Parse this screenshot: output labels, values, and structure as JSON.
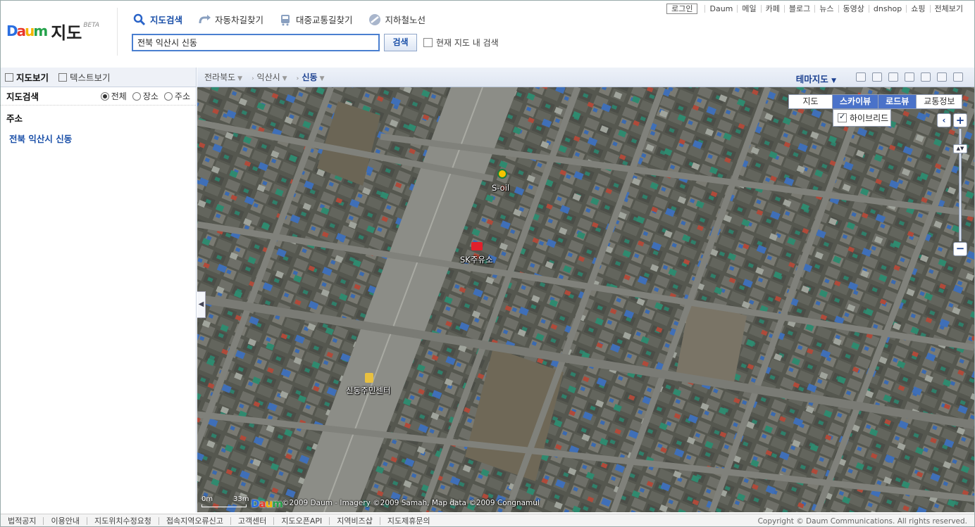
{
  "header": {
    "logo_brand": "Daum",
    "logo_title": "지도",
    "logo_badge": "BETA",
    "nav": [
      {
        "label": "지도검색",
        "icon": "magnifier-icon",
        "active": true
      },
      {
        "label": "자동차길찾기",
        "icon": "car-route-icon",
        "active": false
      },
      {
        "label": "대중교통길찾기",
        "icon": "bus-icon",
        "active": false
      },
      {
        "label": "지하철노선",
        "icon": "subway-icon",
        "active": false
      }
    ],
    "search": {
      "value": "전북 익산시 신동",
      "button": "검색",
      "in_map_label": "현재 지도 내 검색",
      "in_map_checked": false
    },
    "top_links": {
      "login": "로그인",
      "links": [
        "Daum",
        "메일",
        "카페",
        "블로그",
        "뉴스",
        "동영상",
        "dnshop",
        "쇼핑",
        "전체보기"
      ]
    }
  },
  "left_panel": {
    "tabs": [
      {
        "label": "지도보기",
        "active": true
      },
      {
        "label": "텍스트보기",
        "active": false
      }
    ],
    "search_title": "지도검색",
    "search_types": [
      {
        "label": "전체",
        "selected": true
      },
      {
        "label": "장소",
        "selected": false
      },
      {
        "label": "주소",
        "selected": false
      }
    ],
    "result_header": "주소",
    "result_item": "전북 익산시 신동"
  },
  "map_bar": {
    "breadcrumb": [
      "전라북도",
      "익산시",
      "신동"
    ],
    "theme_map": "테마지도"
  },
  "map": {
    "types": [
      {
        "label": "지도",
        "active": false
      },
      {
        "label": "스카이뷰",
        "active": true
      },
      {
        "label": "로드뷰",
        "active": true
      },
      {
        "label": "교통정보",
        "active": false
      }
    ],
    "hybrid_label": "하이브리드",
    "hybrid_checked": true,
    "poi_labels": [
      "S-oil",
      "SK주유소",
      "신동주민센터"
    ],
    "scale_start": "0m",
    "scale_end": "33m",
    "copyright": "©2009 Daum - Imagery ©2009 Samah, Map data ©2009 Congnamul",
    "colors": {
      "accent": "#4a72c9",
      "link": "#1a4fa8"
    }
  },
  "footer": {
    "links": [
      "법적공지",
      "이용안내",
      "지도위치수정요청",
      "접속지역오류신고",
      "고객센터",
      "지도오픈API",
      "지역비즈샵",
      "지도제휴문의"
    ],
    "copyright": "Copyright © Daum Communications. All rights reserved."
  }
}
